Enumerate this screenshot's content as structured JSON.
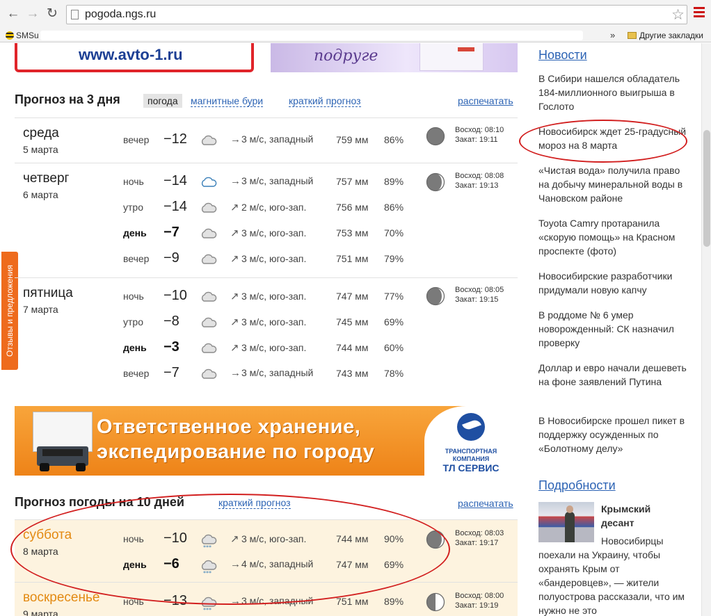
{
  "browser": {
    "url": "pogoda.ngs.ru",
    "bookmark_first": "SMSu",
    "bookmark_other": "Другие закладки",
    "overflow": "»"
  },
  "banners": {
    "top_left_text": "www.avto-1.ru",
    "top_right_text": "подруге",
    "mid_line1": "Ответственное хранение,",
    "mid_line2": "экспедирование по городу",
    "mid_logo_line1": "ТРАНСПОРТНАЯ",
    "mid_logo_line2": "КОМПАНИЯ",
    "mid_logo_line3": "ТЛ СЕРВИС"
  },
  "feedback_tab": "Отзывы и предложения",
  "forecast3": {
    "title": "Прогноз на 3 дня",
    "tab_active": "погода",
    "link_storms": "магнитные бури",
    "link_brief": "краткий прогноз",
    "print": "распечатать",
    "days": [
      {
        "name": "среда",
        "date": "5 марта",
        "sunrise": "Восход: 08:10",
        "sunset": "Закат: 19:11",
        "rows": [
          {
            "tod": "вечер",
            "temp": "−12",
            "wind": "3 м/с, западный",
            "press": "759 мм",
            "hum": "86%"
          }
        ]
      },
      {
        "name": "четверг",
        "date": "6 марта",
        "sunrise": "Восход: 08:08",
        "sunset": "Закат: 19:13",
        "rows": [
          {
            "tod": "ночь",
            "temp": "−14",
            "wind": "3 м/с, западный",
            "press": "757 мм",
            "hum": "89%"
          },
          {
            "tod": "утро",
            "temp": "−14",
            "wind": "2 м/с, юго-зап.",
            "press": "756 мм",
            "hum": "86%"
          },
          {
            "tod": "день",
            "temp": "−7",
            "wind": "3 м/с, юго-зап.",
            "press": "753 мм",
            "hum": "70%"
          },
          {
            "tod": "вечер",
            "temp": "−9",
            "wind": "3 м/с, юго-зап.",
            "press": "751 мм",
            "hum": "79%"
          }
        ]
      },
      {
        "name": "пятница",
        "date": "7 марта",
        "sunrise": "Восход: 08:05",
        "sunset": "Закат: 19:15",
        "rows": [
          {
            "tod": "ночь",
            "temp": "−10",
            "wind": "3 м/с, юго-зап.",
            "press": "747 мм",
            "hum": "77%"
          },
          {
            "tod": "утро",
            "temp": "−8",
            "wind": "3 м/с, юго-зап.",
            "press": "745 мм",
            "hum": "69%"
          },
          {
            "tod": "день",
            "temp": "−3",
            "wind": "3 м/с, юго-зап.",
            "press": "744 мм",
            "hum": "60%"
          },
          {
            "tod": "вечер",
            "temp": "−7",
            "wind": "3 м/с, западный",
            "press": "743 мм",
            "hum": "78%"
          }
        ]
      }
    ]
  },
  "forecast10": {
    "title": "Прогноз погоды на 10 дней",
    "link_brief": "краткий прогноз",
    "print": "распечатать",
    "days": [
      {
        "name": "суббота",
        "date": "8 марта",
        "sunrise": "Восход: 08:03",
        "sunset": "Закат: 19:17",
        "rows": [
          {
            "tod": "ночь",
            "temp": "−10",
            "wind": "3 м/с, юго-зап.",
            "press": "744 мм",
            "hum": "90%"
          },
          {
            "tod": "день",
            "temp": "−6",
            "wind": "4 м/с, западный",
            "press": "747 мм",
            "hum": "69%"
          }
        ]
      },
      {
        "name": "воскресенье",
        "date": "9 марта",
        "sunrise": "Восход: 08:00",
        "sunset": "Закат: 19:19",
        "rows": [
          {
            "tod": "ночь",
            "temp": "−13",
            "wind": "3 м/с, западный",
            "press": "751 мм",
            "hum": "89%"
          }
        ]
      }
    ]
  },
  "news": {
    "title": "Новости",
    "items": [
      "В Сибири нашелся обладатель 184-миллионного выигрыша в Гослото",
      "Новосибирск ждет 25-градусный мороз на 8 марта",
      "«Чистая вода» получила право на добычу минеральной воды в Чановском районе",
      "Toyota Camry протаранила «скорую помощь» на Красном проспекте (фото)",
      "Новосибирские разработчики придумали новую капчу",
      "В роддоме № 6 умер новорожденный: СК назначил проверку",
      "Доллар и евро начали дешеветь на фоне заявлений Путина",
      "В Новосибирске прошел пикет в поддержку осужденных по «Болотному делу»"
    ]
  },
  "details": {
    "title": "Подробности",
    "headline": "Крымский десант",
    "text": "Новосибирцы поехали на Украину, чтобы охранять Крым от «бандеровцев», — жители полуострова рассказали, что им нужно не это"
  },
  "colors": {
    "link": "#2c63b4",
    "highlight_day": "#e38a12",
    "highlight_bg": "#fdf3df",
    "annotation": "#d21f1f",
    "banner_orange": "#ee8318"
  }
}
